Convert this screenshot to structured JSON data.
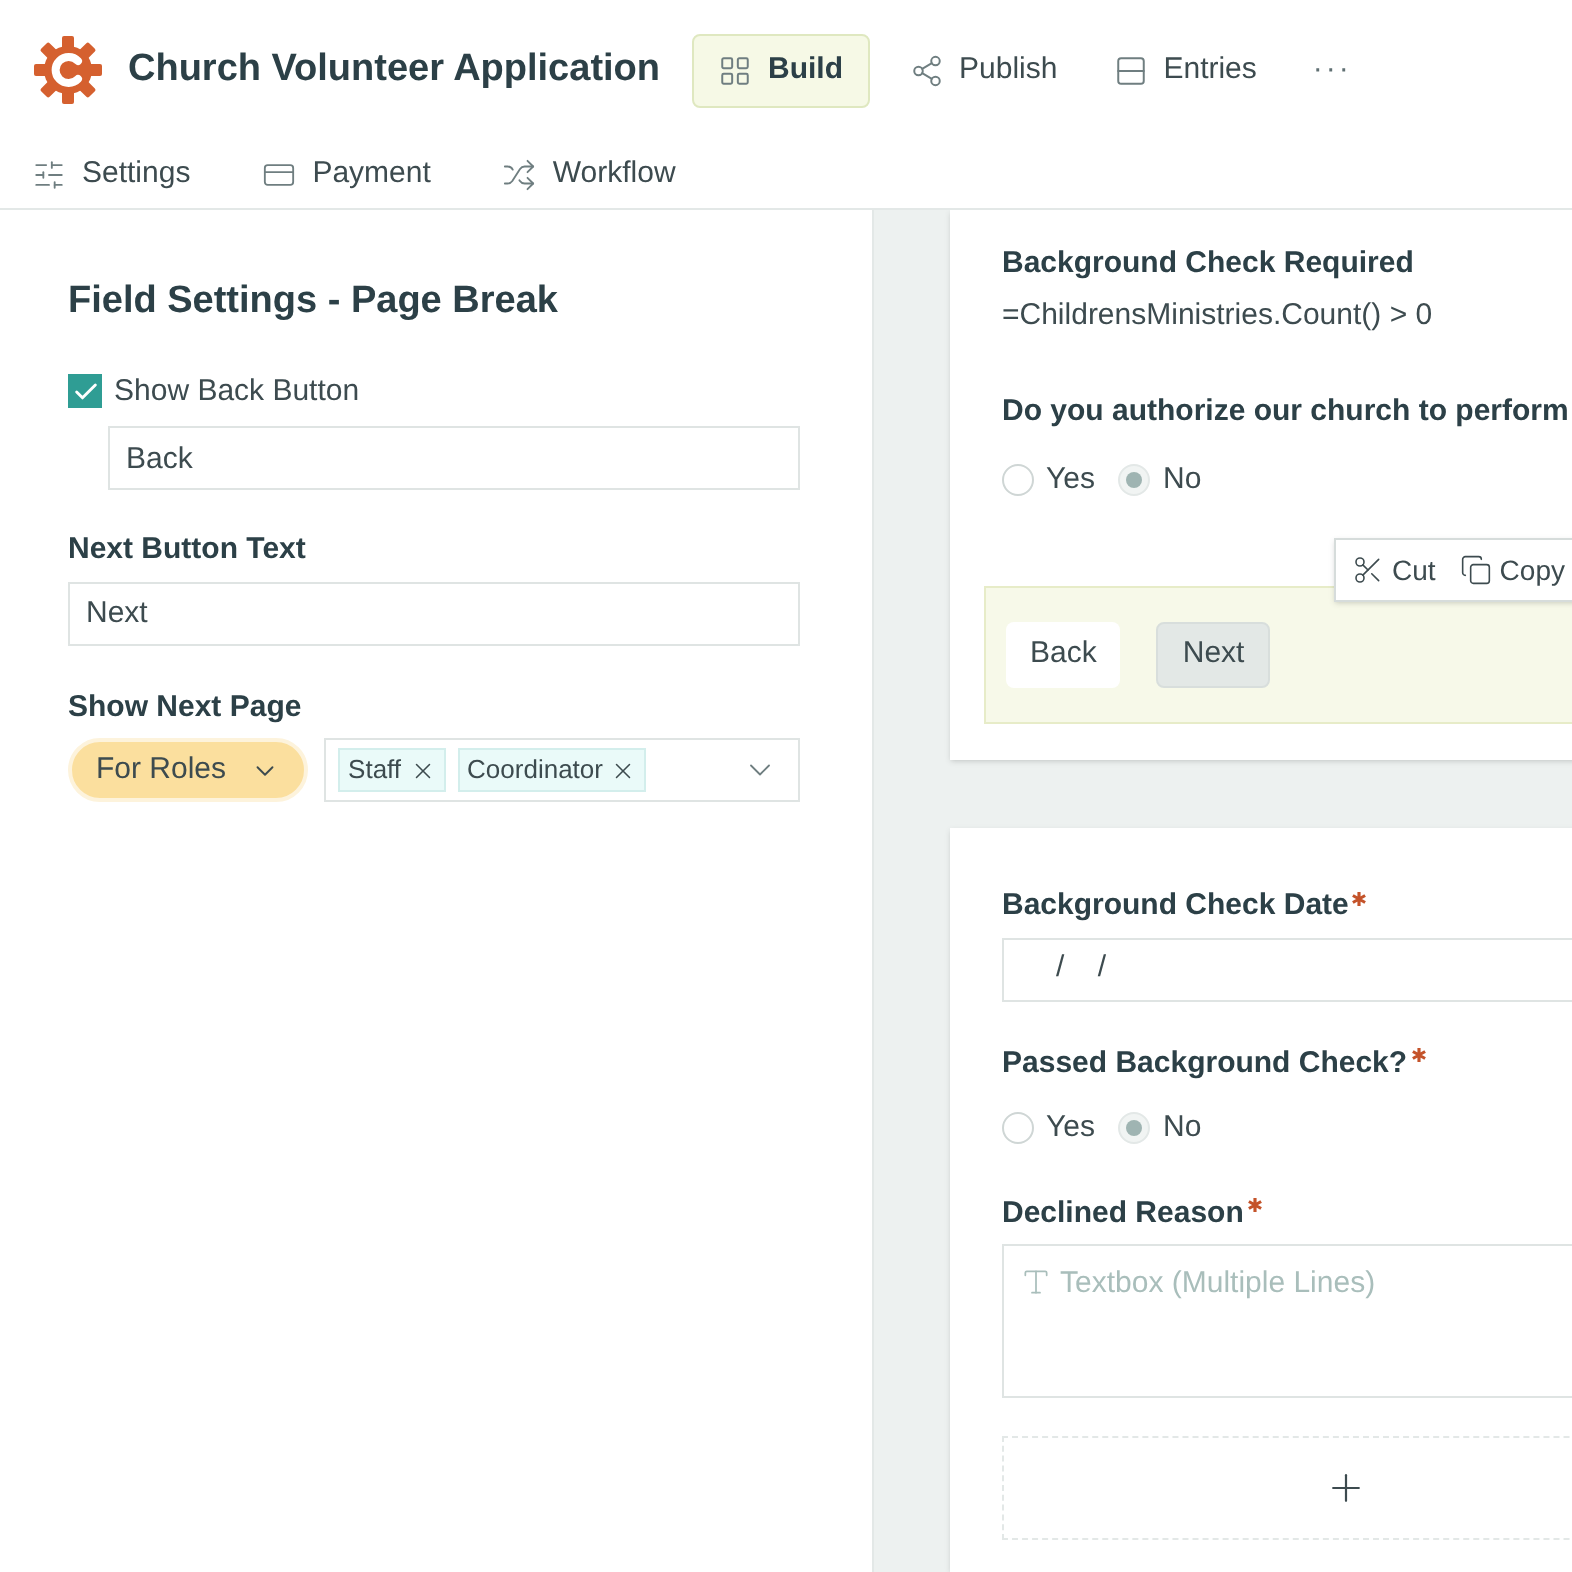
{
  "header": {
    "title": "Church Volunteer Application",
    "tabs": [
      {
        "label": "Build",
        "selected": true
      },
      {
        "label": "Publish",
        "selected": false
      },
      {
        "label": "Entries",
        "selected": false
      }
    ],
    "more": "···"
  },
  "subnav": [
    {
      "label": "Settings"
    },
    {
      "label": "Payment"
    },
    {
      "label": "Workflow"
    }
  ],
  "field_settings": {
    "title": "Field Settings - Page Break",
    "show_back": {
      "label": "Show Back Button",
      "checked": true,
      "value": "Back"
    },
    "next_label": "Next Button Text",
    "next_value": "Next",
    "show_next_label": "Show Next Page",
    "mode": "For Roles",
    "roles": [
      "Staff",
      "Coordinator"
    ]
  },
  "canvas": {
    "page1": {
      "computed_label": "Background Check Required",
      "computed_value": "=ChildrensMinistries.Count() > 0",
      "question": "Do you authorize our church to perform",
      "options": [
        {
          "label": "Yes",
          "selected": false
        },
        {
          "label": "No",
          "selected": true
        }
      ],
      "context_menu": [
        {
          "label": "Cut"
        },
        {
          "label": "Copy"
        }
      ],
      "buttons": [
        "Back",
        "Next"
      ]
    },
    "page2": {
      "fields": [
        {
          "kind": "date",
          "label": "Background Check Date",
          "required": true,
          "value": "/    /"
        },
        {
          "kind": "radio",
          "label": "Passed Background Check?",
          "required": true,
          "options": [
            {
              "label": "Yes",
              "selected": false
            },
            {
              "label": "No",
              "selected": true
            }
          ]
        },
        {
          "kind": "textarea",
          "label": "Declined Reason",
          "required": true,
          "placeholder": "Textbox (Multiple Lines)"
        }
      ]
    }
  }
}
